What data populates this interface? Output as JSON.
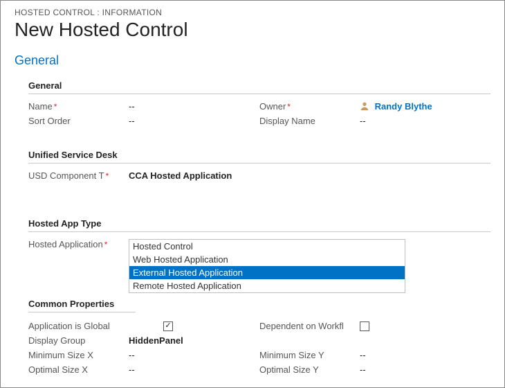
{
  "breadcrumb": "HOSTED CONTROL : INFORMATION",
  "page_title": "New Hosted Control",
  "section_link": "General",
  "groups": {
    "general": {
      "header": "General",
      "name_label": "Name",
      "name_value": "--",
      "owner_label": "Owner",
      "owner_value": "Randy Blythe",
      "sort_order_label": "Sort Order",
      "sort_order_value": "--",
      "display_name_label": "Display Name",
      "display_name_value": "--"
    },
    "usd": {
      "header": "Unified Service Desk",
      "component_label": "USD Component T",
      "component_value": "CCA Hosted Application"
    },
    "app_type": {
      "header": "Hosted App Type",
      "label": "Hosted Application",
      "options": [
        "Hosted Control",
        "Web Hosted Application",
        "External Hosted Application",
        "Remote Hosted Application"
      ],
      "selected_index": 2
    },
    "common": {
      "header": "Common Properties",
      "global_label": "Application is Global",
      "global_checked": true,
      "dependent_label": "Dependent on Workfl",
      "dependent_checked": false,
      "display_group_label": "Display Group",
      "display_group_value": "HiddenPanel",
      "min_x_label": "Minimum Size X",
      "min_x_value": "--",
      "min_y_label": "Minimum Size Y",
      "min_y_value": "--",
      "opt_x_label": "Optimal Size X",
      "opt_x_value": "--",
      "opt_y_label": "Optimal Size Y",
      "opt_y_value": "--"
    }
  }
}
